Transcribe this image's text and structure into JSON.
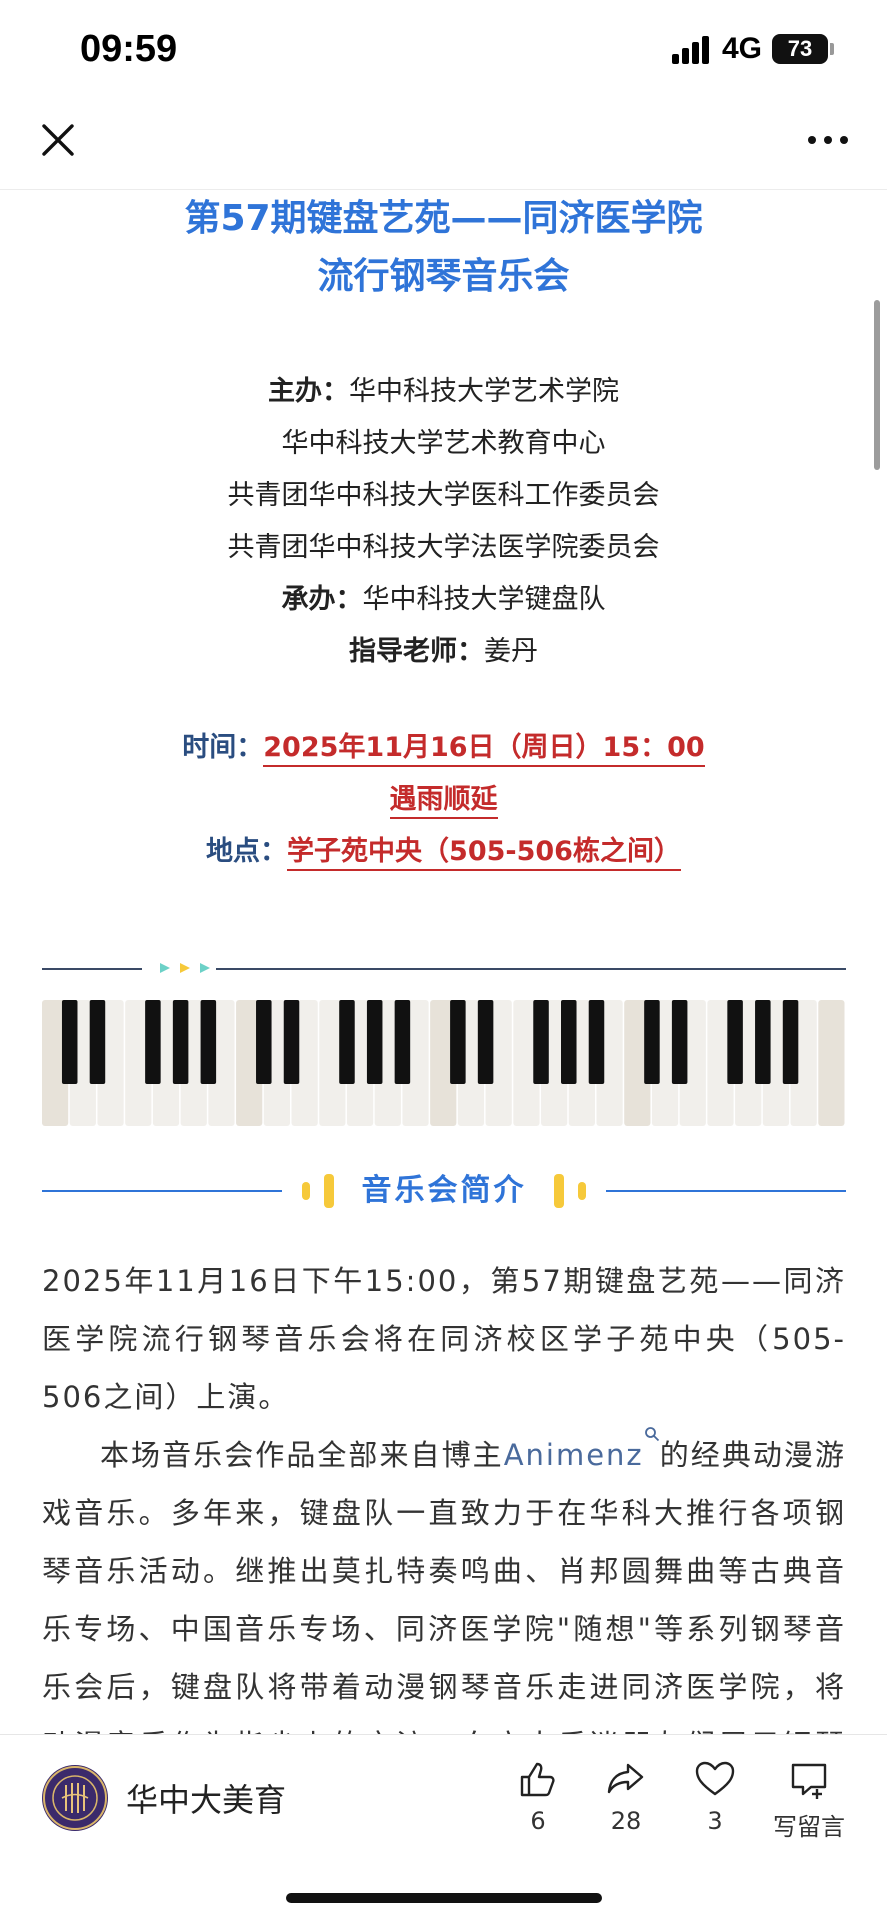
{
  "status_bar": {
    "time": "09:59",
    "network": "4G",
    "battery": "73"
  },
  "nav": {
    "close_icon": "close-icon",
    "more_icon": "more-icon"
  },
  "article": {
    "title_line1": "第57期键盘艺苑——同济医学院",
    "title_line2": "流行钢琴音乐会",
    "organizers": {
      "host_label": "主办：",
      "host_1": "华中科技大学艺术学院",
      "host_2": "华中科技大学艺术教育中心",
      "host_3": "共青团华中科技大学医科工作委员会",
      "host_4": "共青团华中科技大学法医学院委员会",
      "organizer_label": "承办：",
      "organizer": "华中科技大学键盘队",
      "advisor_label": "指导老师：",
      "advisor": "姜丹"
    },
    "event": {
      "time_label": "时间：",
      "time_value": "2025年11月16日（周日）15：00",
      "rain_note": "遇雨顺延",
      "place_label": "地点：",
      "place_value": "学子苑中央（505-506栋之间）"
    },
    "section_title": "音乐会简介",
    "para1": " 2025年11月16日下午15:00，第57期键盘艺苑——同济医学院流行钢琴音乐会将在同济校区学子苑中央（505-506之间）上演。",
    "para2_before": "本场音乐会作品全部来自博主",
    "para2_link": "Animenz",
    "para2_after": "的经典动漫游戏音乐。多年来，键盘队一直致力于在华科大推行各项钢琴音乐活动。继推出莫扎特奏鸣曲、肖邦圆舞曲等古典音乐专场、中国音乐专场、同济医学院\"随想\"等系列钢琴音乐会后，键盘队将带着动漫钢琴音乐走进同济医学院，将动漫音乐作为指尖上的交流，向广大乐迷朋友们展示钢琴音乐的魅力。"
  },
  "bottom_bar": {
    "account_name": "华中大美育",
    "like_count": "6",
    "share_count": "28",
    "favorite_count": "3",
    "comment_label": "写留言"
  },
  "colors": {
    "title_blue": "#2f74d8",
    "label_navy": "#2a4d80",
    "accent_red": "#c42b2b",
    "accent_yellow": "#f6c93a"
  }
}
